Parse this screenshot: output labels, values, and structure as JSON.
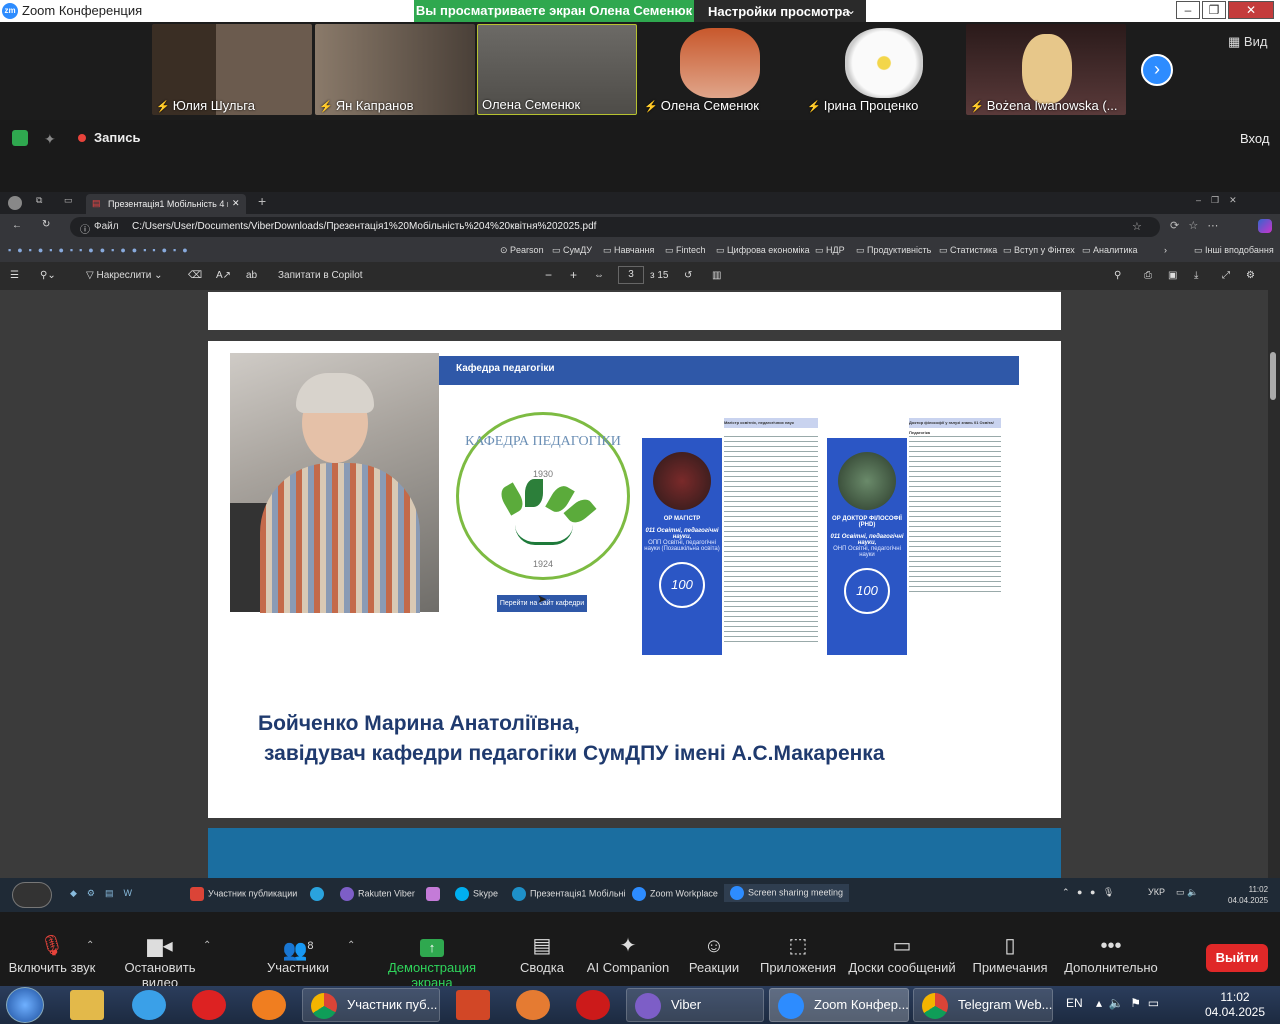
{
  "zoom": {
    "window_title": "Zoom Конференция",
    "share_banner": "Вы просматриваете экран Олена Семенюк",
    "view_settings": "Настройки просмотра",
    "view_button": "Вид",
    "record": "Запись",
    "login": "Вход",
    "participants": [
      {
        "name": "Юлия Шульга",
        "muted": true
      },
      {
        "name": "Ян Капранов",
        "muted": true
      },
      {
        "name": "Олена Семенюк",
        "muted": false
      },
      {
        "name": "Олена Семенюк",
        "muted": true
      },
      {
        "name": "Ірина Проценко",
        "muted": true
      },
      {
        "name": "Bożena Iwanowska (...",
        "muted": true
      }
    ],
    "toolbar": {
      "audio": "Включить звук",
      "video": "Остановить видео",
      "participants": "Участники",
      "participants_count": "8",
      "share": "Демонстрация экрана",
      "summary": "Сводка",
      "ai": "AI Companion",
      "reactions": "Реакции",
      "apps": "Приложения",
      "whiteboards": "Доски сообщений",
      "notes": "Примечания",
      "more": "Дополнительно",
      "exit": "Выйти"
    }
  },
  "browser": {
    "tab_title": "Презентація1 Мобільність 4 кві",
    "file_label": "Файл",
    "url": "C:/Users/User/Documents/ViberDownloads/Презентація1%20Мобільність%204%20квітня%202025.pdf",
    "bookmarks": [
      "Pearson",
      "СумДУ",
      "Навчання",
      "Fintech",
      "Цифрова економіка",
      "НДР",
      "Продуктивність",
      "Статистика",
      "Вступ у Фінтех",
      "Аналитика",
      "Інші вподобання"
    ],
    "pdf_toolbar": {
      "draw": "Накреслити",
      "copilot": "Запитати в Copilot",
      "page": "3",
      "of_pages": "з 15"
    }
  },
  "slide": {
    "header": "Кафедра педагогіки",
    "logo_text": "КАФЕДРА ПЕДАГОГІКИ",
    "logo_year_top": "1930",
    "logo_year_bottom": "1924",
    "goto_button": "Перейти на сайт кафедри",
    "brochure1": {
      "degree": "ОР МАГІСТР",
      "program": "011 Освітні, педагогічні науки,",
      "sub": "ОПП Освітні, педагогічні науки (Позашкільна освіта)",
      "badge": "100"
    },
    "brochure1_text_title": "Магістр освітніх, педагогічних наук",
    "brochure2": {
      "degree": "ОР ДОКТОР ФІЛОСОФІЇ (PHD)",
      "program": "011 Освітні, педагогічні науки,",
      "sub": "ОНП Освітні, педагогічні науки",
      "badge": "100"
    },
    "brochure2_text_title": "Доктор філософії у галузі знань 01 Освіта/Педагогіка",
    "name": "Бойченко Марина Анатоліївна,",
    "role": "завідувач кафедри педагогіки СумДПУ імені А.С.Макаренка"
  },
  "shared_taskbar": {
    "items": [
      "Участник публикации",
      "Rakuten Viber",
      "Skype",
      "Презентація1 Мобільні",
      "Zoom Workplace",
      "Screen sharing meeting"
    ],
    "lang": "УКР",
    "time": "11:02",
    "date": "04.04.2025"
  },
  "windows_taskbar": {
    "items": [
      "Участник пуб...",
      "Viber",
      "Zoom Конфер...",
      "Telegram Web..."
    ],
    "lang": "EN",
    "time": "11:02",
    "date": "04.04.2025"
  }
}
